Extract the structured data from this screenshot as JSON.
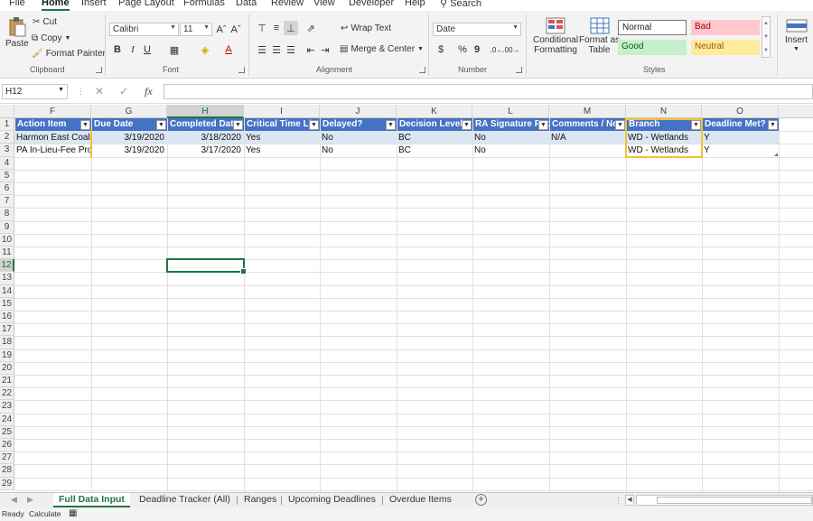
{
  "menu": [
    "File",
    "Home",
    "Insert",
    "Page Layout",
    "Formulas",
    "Data",
    "Review",
    "View",
    "Developer",
    "Help"
  ],
  "menu_active": "Home",
  "search_label": "Search",
  "ribbon": {
    "clipboard": {
      "paste": "Paste",
      "cut": "Cut",
      "copy": "Copy",
      "format_painter": "Format Painter",
      "label": "Clipboard"
    },
    "font": {
      "name": "Calibri",
      "size": "11",
      "label": "Font",
      "bold": "B",
      "italic": "I",
      "underline": "U"
    },
    "alignment": {
      "wrap_text": "Wrap Text",
      "merge_center": "Merge & Center",
      "label": "Alignment"
    },
    "number": {
      "format": "Date",
      "currency": "$",
      "percent": "%",
      "comma": "9",
      "label": "Number"
    },
    "styles": {
      "conditional_formatting": [
        "Conditional",
        "Formatting"
      ],
      "format_as_table": [
        "Format as",
        "Table"
      ],
      "normal": "Normal",
      "bad": "Bad",
      "good": "Good",
      "neutral": "Neutral",
      "label": "Styles"
    },
    "cells": {
      "insert": "Insert"
    }
  },
  "formula_bar": {
    "name_box": "H12",
    "fx": "fx",
    "value": ""
  },
  "columns": [
    "F",
    "G",
    "H",
    "I",
    "J",
    "K",
    "L",
    "M",
    "N",
    "O"
  ],
  "selected_column": "H",
  "rows": [
    "1",
    "2",
    "3",
    "4",
    "5",
    "6",
    "7",
    "8",
    "9",
    "10",
    "11",
    "12",
    "13",
    "14",
    "15",
    "16",
    "17",
    "18",
    "19",
    "20",
    "21",
    "22",
    "23",
    "24",
    "25",
    "26",
    "27",
    "28",
    "29"
  ],
  "selected_row": "12",
  "table_headers": [
    "Action Item",
    "Due Date",
    "Completed Date",
    "Critical Time Limit",
    "Delayed?",
    "Decision Level",
    "RA Signature Required",
    "Comments / Notes",
    "Branch",
    "Deadline Met?"
  ],
  "table_rows": [
    [
      "Harmon East Coal",
      "3/19/2020",
      "3/18/2020",
      "Yes",
      "No",
      "BC",
      "No",
      "N/A",
      "WD - Wetlands",
      "Y"
    ],
    [
      "PA In-Lieu-Fee Proj",
      "3/19/2020",
      "3/17/2020",
      "Yes",
      "No",
      "BC",
      "No",
      "",
      "WD - Wetlands",
      "Y"
    ]
  ],
  "sheet_tabs": [
    "Full Data Input",
    "Deadline Tracker (All)",
    "Ranges",
    "Upcoming Deadlines",
    "Overdue Items"
  ],
  "active_sheet": "Full Data Input",
  "status": {
    "ready": "Ready",
    "calculate": "Calculate"
  },
  "colors": {
    "accent": "#217346",
    "table_header": "#4472c4",
    "band": "#dce6f2",
    "highlight": "#f3c12f",
    "bad_bg": "#ffc7ce",
    "bad_fg": "#9c0006",
    "good_bg": "#c6efce",
    "good_fg": "#006100",
    "neutral_bg": "#ffeb9c",
    "neutral_fg": "#9c5700"
  }
}
